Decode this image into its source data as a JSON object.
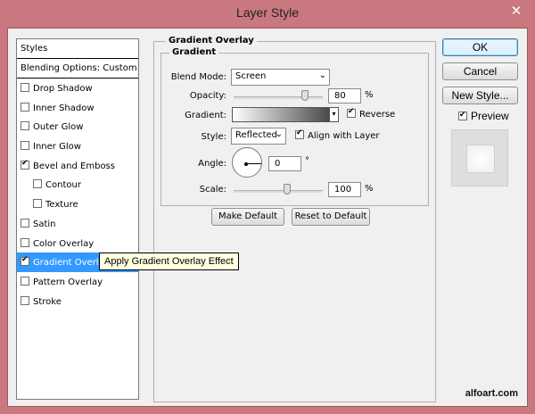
{
  "window": {
    "title": "Layer Style",
    "close_glyph": "✕"
  },
  "styles_panel": {
    "header": "Styles",
    "blending": "Blending Options: Custom",
    "items": [
      {
        "label": "Drop Shadow",
        "checked": false,
        "sub": false,
        "selected": false
      },
      {
        "label": "Inner Shadow",
        "checked": false,
        "sub": false,
        "selected": false
      },
      {
        "label": "Outer Glow",
        "checked": false,
        "sub": false,
        "selected": false
      },
      {
        "label": "Inner Glow",
        "checked": false,
        "sub": false,
        "selected": false
      },
      {
        "label": "Bevel and Emboss",
        "checked": true,
        "sub": false,
        "selected": false
      },
      {
        "label": "Contour",
        "checked": false,
        "sub": true,
        "selected": false
      },
      {
        "label": "Texture",
        "checked": false,
        "sub": true,
        "selected": false
      },
      {
        "label": "Satin",
        "checked": false,
        "sub": false,
        "selected": false
      },
      {
        "label": "Color Overlay",
        "checked": false,
        "sub": false,
        "selected": false
      },
      {
        "label": "Gradient Overlay",
        "checked": true,
        "sub": false,
        "selected": true
      },
      {
        "label": "Pattern Overlay",
        "checked": false,
        "sub": false,
        "selected": false
      },
      {
        "label": "Stroke",
        "checked": false,
        "sub": false,
        "selected": false
      }
    ]
  },
  "tooltip": "Apply Gradient Overlay Effect",
  "gradient_overlay": {
    "group_title": "Gradient Overlay",
    "sub_title": "Gradient",
    "blend_mode_label": "Blend Mode:",
    "blend_mode_value": "Screen",
    "opacity_label": "Opacity:",
    "opacity_value": "80",
    "opacity_unit": "%",
    "opacity_level": 0.8,
    "gradient_label": "Gradient:",
    "reverse_label": "Reverse",
    "reverse_checked": true,
    "style_label": "Style:",
    "style_value": "Reflected",
    "align_label": "Align with Layer",
    "align_checked": true,
    "angle_label": "Angle:",
    "angle_value": "0",
    "angle_unit": "°",
    "scale_label": "Scale:",
    "scale_value": "100",
    "scale_unit": "%",
    "scale_level": 0.6,
    "make_default": "Make Default",
    "reset_default": "Reset to Default"
  },
  "side_buttons": {
    "ok": "OK",
    "cancel": "Cancel",
    "new_style": "New Style...",
    "preview_label": "Preview",
    "preview_checked": true
  },
  "watermark": "alfoart.com",
  "colors": {
    "titlebar": "#c9787f",
    "selection": "#3399ff",
    "dialog": "#f0f0f0"
  }
}
